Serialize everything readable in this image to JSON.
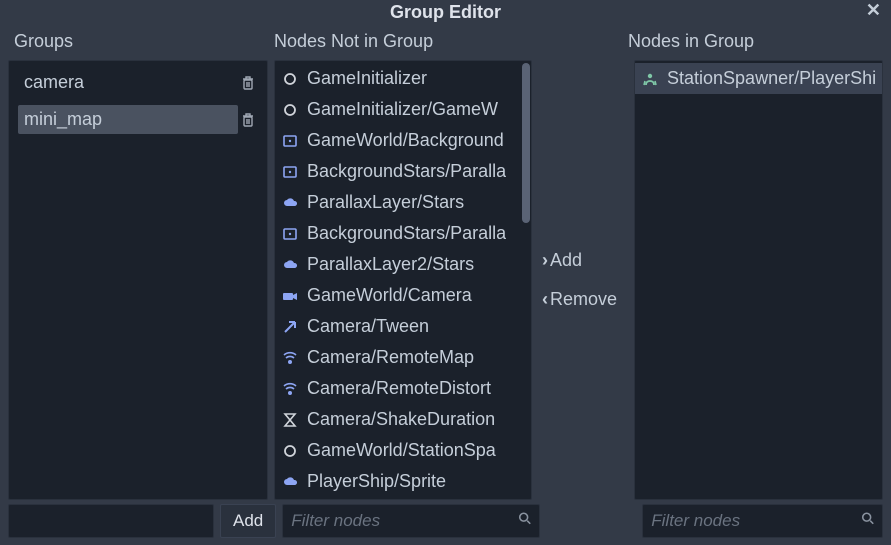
{
  "window": {
    "title": "Group Editor"
  },
  "headers": {
    "groups": "Groups",
    "nodes_not_in": "Nodes Not in Group",
    "nodes_in": "Nodes in Group"
  },
  "groups": {
    "items": [
      {
        "name": "camera",
        "selected": false
      },
      {
        "name": "mini_map",
        "selected": true
      }
    ]
  },
  "center": {
    "add": "Add",
    "remove": "Remove"
  },
  "nodes_not_in": {
    "items": [
      {
        "icon": "node",
        "name": "GameInitializer"
      },
      {
        "icon": "node",
        "name": "GameInitializer/GameW"
      },
      {
        "icon": "canvas",
        "name": "GameWorld/Background"
      },
      {
        "icon": "canvas",
        "name": "BackgroundStars/Paralla"
      },
      {
        "icon": "cloud",
        "name": "ParallaxLayer/Stars"
      },
      {
        "icon": "canvas",
        "name": "BackgroundStars/Paralla"
      },
      {
        "icon": "cloud",
        "name": "ParallaxLayer2/Stars"
      },
      {
        "icon": "camera",
        "name": "GameWorld/Camera"
      },
      {
        "icon": "arrow",
        "name": "Camera/Tween"
      },
      {
        "icon": "remote",
        "name": "Camera/RemoteMap"
      },
      {
        "icon": "remote",
        "name": "Camera/RemoteDistort"
      },
      {
        "icon": "timer",
        "name": "Camera/ShakeDuration"
      },
      {
        "icon": "node",
        "name": "GameWorld/StationSpa"
      },
      {
        "icon": "cloud",
        "name": "PlayerShip/Sprite"
      }
    ]
  },
  "nodes_in": {
    "items": [
      {
        "icon": "anim",
        "name": "StationSpawner/PlayerShi",
        "selected": true
      }
    ]
  },
  "bottom": {
    "new_group_placeholder": "",
    "add_button": "Add",
    "filter_notin_placeholder": "Filter nodes",
    "filter_in_placeholder": "Filter nodes"
  }
}
